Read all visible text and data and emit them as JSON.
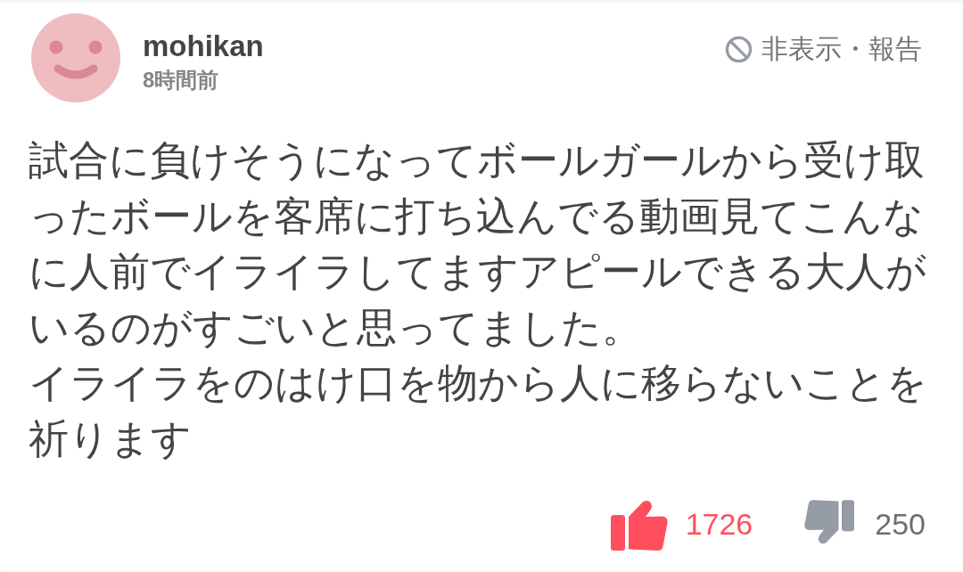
{
  "comment": {
    "author": {
      "name": "mohikan",
      "posted": "8時間前"
    },
    "report_link": "非表示・報告",
    "body": [
      "試合に負けそうになってボールガールから受け取ったボールを客席に打ち込んでる動画見てこんなに人前でイライラしてますアピールできる大人がいるのがすごいと思ってました。",
      "イライラをのはけ口を物から人に移らないことを祈ります"
    ],
    "reactions": [
      {
        "kind": "like",
        "count": "1726"
      },
      {
        "kind": "dislike",
        "count": "250"
      }
    ]
  }
}
